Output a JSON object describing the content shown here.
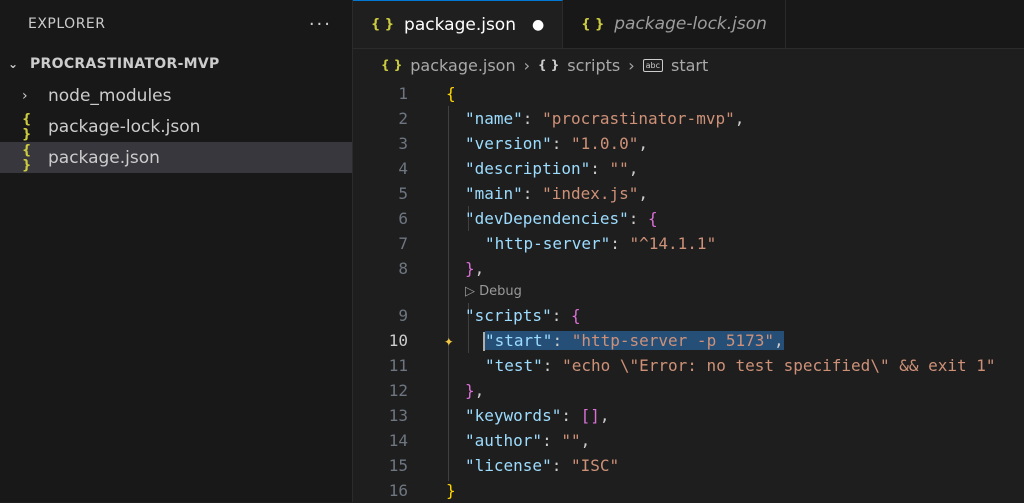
{
  "sidebar": {
    "title": "EXPLORER",
    "more": "···",
    "project": "PROCRASTINATOR-MVP",
    "items": [
      {
        "label": "node_modules",
        "icon": "›"
      },
      {
        "label": "package-lock.json",
        "icon": "{ }"
      },
      {
        "label": "package.json",
        "icon": "{ }"
      }
    ]
  },
  "tabs": [
    {
      "label": "package.json",
      "icon": "{ }",
      "dirty": "●"
    },
    {
      "label": "package-lock.json",
      "icon": "{ }"
    }
  ],
  "breadcrumb": {
    "file": "package.json",
    "section": "scripts",
    "key": "start",
    "key_icon": "abc",
    "sep": "›"
  },
  "codelens": "▷ Debug",
  "code": {
    "line_numbers": [
      "1",
      "2",
      "3",
      "4",
      "5",
      "6",
      "7",
      "8",
      "9",
      "10",
      "11",
      "12",
      "13",
      "14",
      "15",
      "16"
    ],
    "lines": {
      "l1_brace": "{",
      "name_key": "\"name\"",
      "name_val": "\"procrastinator-mvp\"",
      "version_key": "\"version\"",
      "version_val": "\"1.0.0\"",
      "description_key": "\"description\"",
      "description_val": "\"\"",
      "main_key": "\"main\"",
      "main_val": "\"index.js\"",
      "devdeps_key": "\"devDependencies\"",
      "devdeps_open": "{",
      "httpserver_key": "\"http-server\"",
      "httpserver_val": "\"^14.1.1\"",
      "devdeps_close": "}",
      "scripts_key": "\"scripts\"",
      "scripts_open": "{",
      "start_key": "\"start\"",
      "start_val": "\"http-server -p 5173\"",
      "test_key": "\"test\"",
      "test_val": "\"echo \\\"Error: no test specified\\\" && exit 1\"",
      "scripts_close": "}",
      "keywords_key": "\"keywords\"",
      "keywords_val": "[]",
      "author_key": "\"author\"",
      "author_val": "\"\"",
      "license_key": "\"license\"",
      "license_val": "\"ISC\"",
      "l16_brace": "}"
    }
  },
  "colors": {
    "json_icon": "#cbcb41",
    "key": "#9cdcfe",
    "string": "#ce9178",
    "selection": "#264f78"
  }
}
